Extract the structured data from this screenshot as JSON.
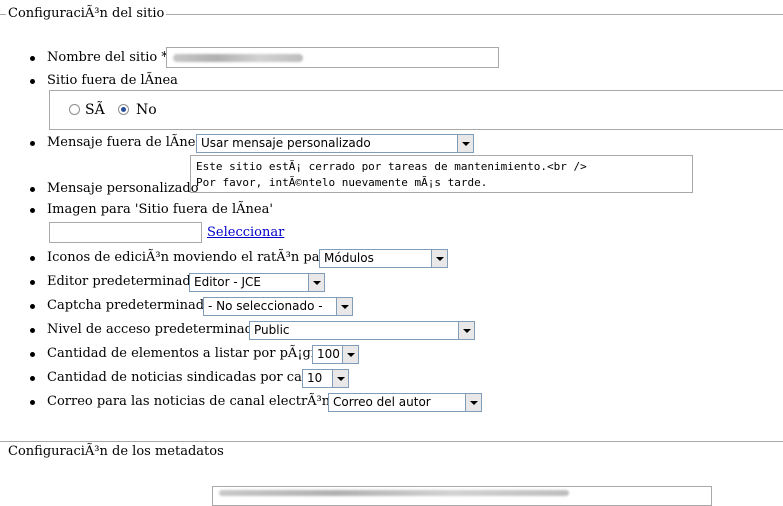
{
  "site_section": {
    "legend": "ConfiguraciÃ³n del sitio",
    "site_name_label": "Nombre del sitio *",
    "offline_label": "Sitio fuera de lÃnea",
    "offline_yes": "SÃ",
    "offline_no": "No",
    "offline_selected": "No",
    "offline_message_label": "Mensaje fuera de lÃnea",
    "offline_message_value": "Usar mensaje personalizado",
    "custom_message_label": "Mensaje personalizado",
    "custom_message_value": "Este sitio estÃ¡ cerrado por tareas de mantenimiento.<br />\nPor favor, intÃ©ntelo nuevamente mÃ¡s tarde.",
    "offline_image_label": "Imagen para 'Sitio fuera de lÃnea'",
    "select_link": "Seleccionar",
    "edit_icons_label": "Iconos de ediciÃ³n moviendo el ratÃ³n para",
    "edit_icons_value": "Módulos",
    "default_editor_label": "Editor predeterminado",
    "default_editor_value": "Editor - JCE",
    "default_captcha_label": "Captcha predeterminado",
    "default_captcha_value": "- No seleccionado -",
    "default_access_label": "Nivel de acceso predeterminado",
    "default_access_value": "Public",
    "list_limit_label": "Cantidad de elementos a listar por pÃ¡gina",
    "list_limit_value": "100",
    "feed_limit_label": "Cantidad de noticias sindicadas por canal",
    "feed_limit_value": "10",
    "feed_email_label": "Correo para las noticias de canal electrÃ³nico",
    "feed_email_value": "Correo del autor"
  },
  "meta_section": {
    "legend": "ConfiguraciÃ³n de los metadatos"
  }
}
